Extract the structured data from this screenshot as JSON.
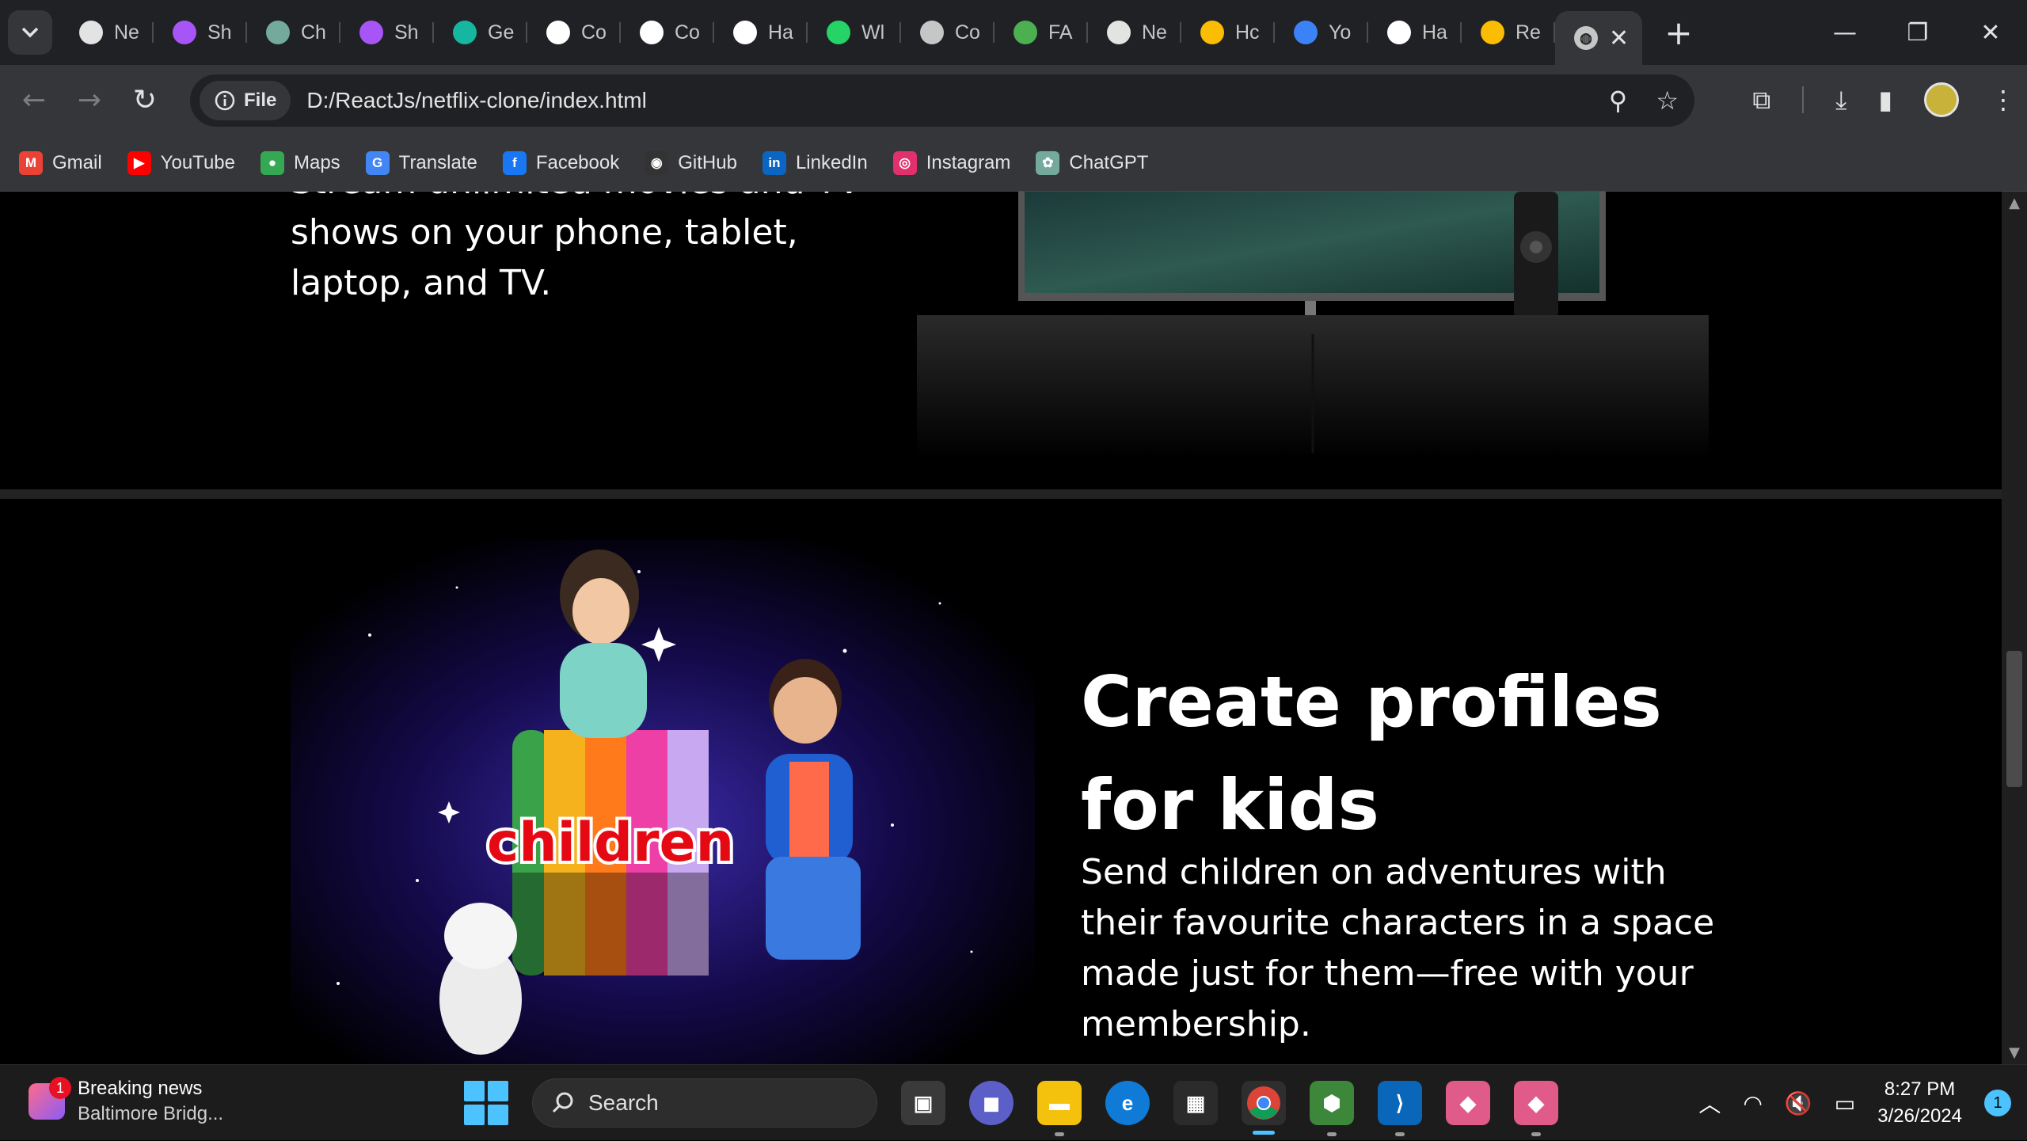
{
  "browser": {
    "tabs": [
      {
        "label": "Ne",
        "icon": "chrome-icon",
        "color": "#e3e3e3"
      },
      {
        "label": "Sh",
        "icon": "app-icon",
        "color": "#a855f7"
      },
      {
        "label": "Ch",
        "icon": "chatgpt-icon",
        "color": "#74aa9c"
      },
      {
        "label": "Sh",
        "icon": "app-icon",
        "color": "#a855f7"
      },
      {
        "label": "Ge",
        "icon": "gemini-icon",
        "color": "#17b6a0"
      },
      {
        "label": "Co",
        "icon": "hashnode-icon",
        "color": "#ffffff"
      },
      {
        "label": "Co",
        "icon": "hashnode-icon",
        "color": "#ffffff"
      },
      {
        "label": "Ha",
        "icon": "github-icon",
        "color": "#ffffff"
      },
      {
        "label": "Wl",
        "icon": "whatsapp-icon",
        "color": "#25d366"
      },
      {
        "label": "Co",
        "icon": "globe-icon",
        "color": "#c4c7c5"
      },
      {
        "label": "FA",
        "icon": "leaf-icon",
        "color": "#4caf50"
      },
      {
        "label": "Ne",
        "icon": "chrome-icon",
        "color": "#e3e3e3"
      },
      {
        "label": "Hc",
        "icon": "drive-icon",
        "color": "#fbbc04"
      },
      {
        "label": "Yo",
        "icon": "r-icon",
        "color": "#3b82f6"
      },
      {
        "label": "Ha",
        "icon": "github-icon",
        "color": "#ffffff"
      },
      {
        "label": "Re",
        "icon": "drive-icon",
        "color": "#fbbc04"
      }
    ],
    "active_tab": {
      "icon": "globe-icon",
      "close": "✕"
    },
    "new_tab": "+",
    "window_controls": {
      "minimize": "—",
      "restore": "❐",
      "close": "✕"
    },
    "toolbar": {
      "back": "←",
      "forward": "→",
      "reload": "↻",
      "chip_label": "File",
      "url": "D:/ReactJs/netflix-clone/index.html",
      "zoom": "⚲",
      "bookmark_star": "☆",
      "extensions": "⧉",
      "downloads": "⤓",
      "side_panel": "▮",
      "menu": "⋮"
    },
    "bookmarks": [
      {
        "label": "Gmail",
        "icon": "gmail-icon",
        "glyph": "M",
        "color": "#ea4335"
      },
      {
        "label": "YouTube",
        "icon": "youtube-icon",
        "glyph": "▶",
        "color": "#ff0000"
      },
      {
        "label": "Maps",
        "icon": "maps-icon",
        "glyph": "●",
        "color": "#34a853"
      },
      {
        "label": "Translate",
        "icon": "translate-icon",
        "glyph": "G",
        "color": "#4285f4"
      },
      {
        "label": "Facebook",
        "icon": "facebook-icon",
        "glyph": "f",
        "color": "#1877f2"
      },
      {
        "label": "GitHub",
        "icon": "github-icon",
        "glyph": "◉",
        "color": "#333333"
      },
      {
        "label": "LinkedIn",
        "icon": "linkedin-icon",
        "glyph": "in",
        "color": "#0a66c2"
      },
      {
        "label": "Instagram",
        "icon": "instagram-icon",
        "glyph": "◎",
        "color": "#e1306c"
      },
      {
        "label": "ChatGPT",
        "icon": "chatgpt-icon",
        "glyph": "✿",
        "color": "#74aa9c"
      }
    ]
  },
  "page": {
    "tv_section": {
      "text_partial": "Stream unlimited movies and TV shows on your phone, tablet, laptop, and TV."
    },
    "kids_section": {
      "title": "Create profiles for kids",
      "description": "Send children on adventures with their favourite characters in a space made just for them—free with your membership.",
      "image_label": "children"
    }
  },
  "taskbar": {
    "news": {
      "badge": "1",
      "title": "Breaking news",
      "subtitle": "Baltimore Bridg..."
    },
    "search_label": "Search",
    "tray": {
      "chevron": "︿",
      "wifi": "◠",
      "volume": "🔇",
      "battery": "▭"
    },
    "clock": {
      "time": "8:27 PM",
      "date": "3/26/2024"
    },
    "notifications": "1"
  }
}
